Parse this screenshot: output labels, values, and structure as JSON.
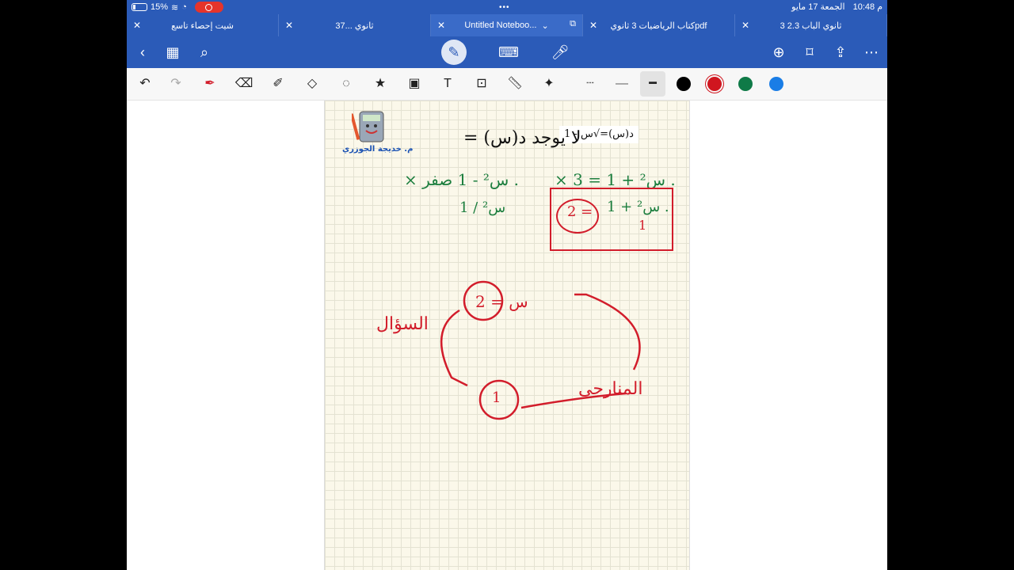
{
  "status": {
    "battery": "15%",
    "time": "10:48 م",
    "date": "الجمعة 17 مايو"
  },
  "tabs": [
    {
      "label": "شيت إحصاء تاسع"
    },
    {
      "label": "3ثانوي ...7"
    },
    {
      "label": "Untitled Noteboo..."
    },
    {
      "label": "كتاب الرياضيات 3 ثانويpdf"
    },
    {
      "label": "3 ثانوي الباب 2.3"
    }
  ],
  "icons": {
    "back": "chevron-left-icon",
    "grid": "grid-icon",
    "search": "search-icon",
    "pen": "pen-icon",
    "keyboard": "keyboard-icon",
    "mic": "microphone-icon",
    "add_page": "add-page-icon",
    "bookmark": "bookmark-icon",
    "share": "share-icon",
    "more": "more-icon"
  },
  "colors": {
    "brand": "#2b5bb8",
    "swatches": [
      "#000000",
      "#d0161f",
      "#0f7a47",
      "#1a7de6"
    ]
  },
  "notebook": {
    "printed_equation": "د(س)=√س - 1",
    "signature": "م. خديجة الجوزري",
    "handwriting": {
      "top_left": "لا يوجد د(س) =",
      "green_left_1": ". س² - 1 صفر ×",
      "green_left_2": "1 / س²",
      "green_right_1": ". س² + 1 = 3 ×",
      "green_right_2": ". س² + 1",
      "boxed_red": "2 =",
      "boxed_red_2": "1",
      "diagram_left": "السؤال",
      "diagram_right": "المنارجي",
      "diagram_top": "س = 2",
      "diagram_bottom": "1"
    }
  }
}
